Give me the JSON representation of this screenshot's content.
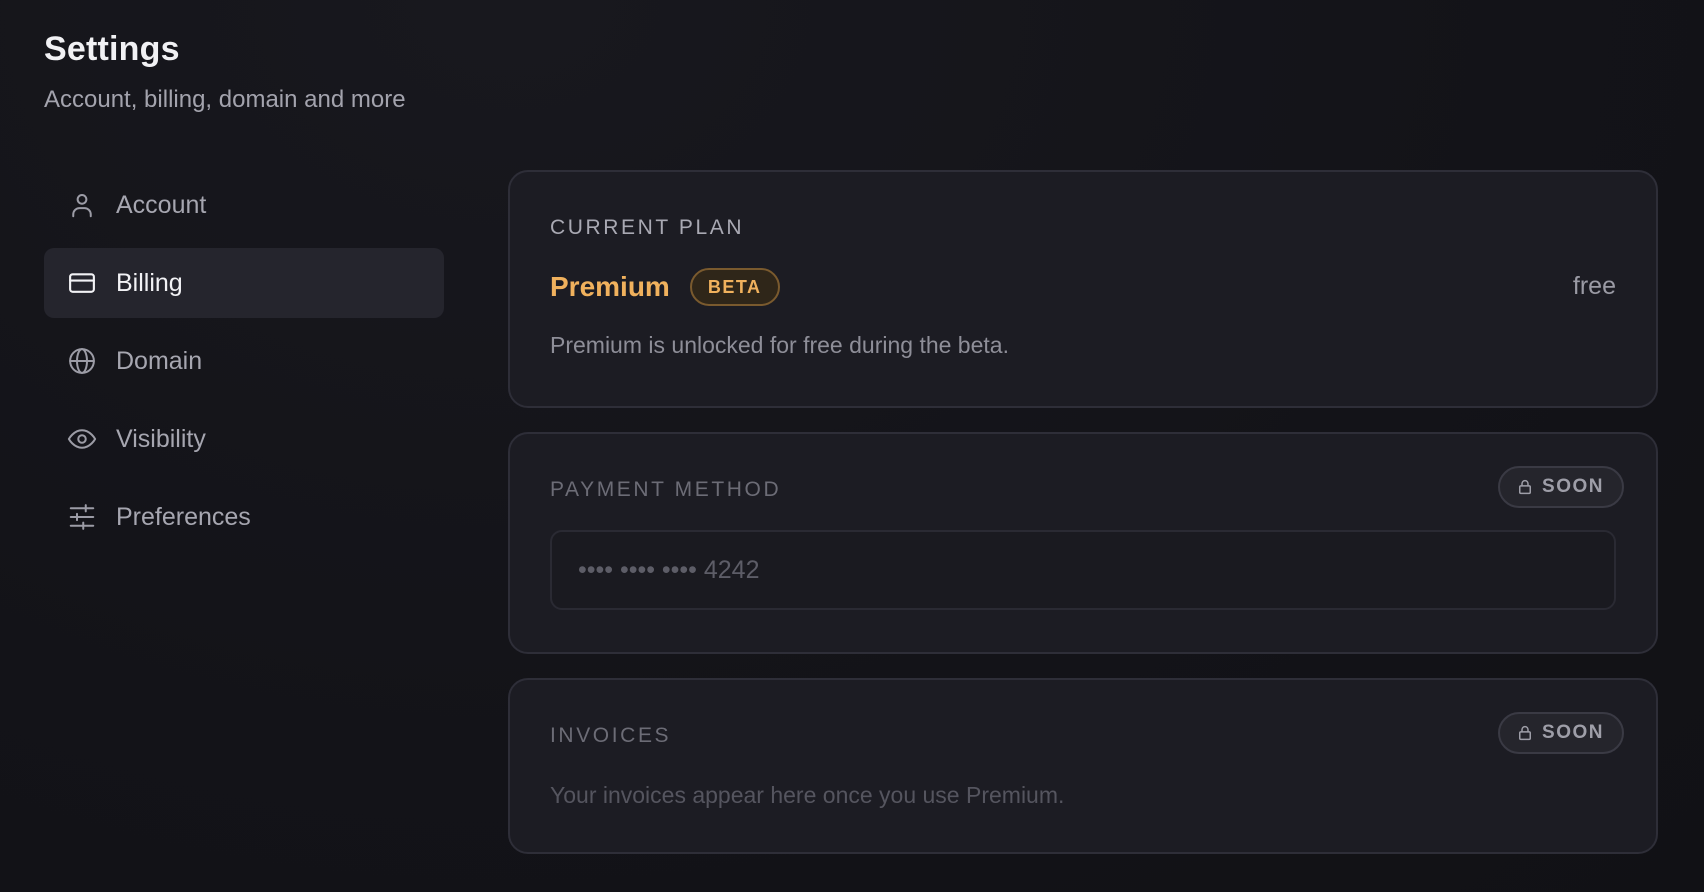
{
  "header": {
    "title": "Settings",
    "subtitle": "Account, billing, domain and more"
  },
  "sidebar": {
    "items": [
      {
        "label": "Account",
        "icon": "user-icon",
        "active": false
      },
      {
        "label": "Billing",
        "icon": "credit-card-icon",
        "active": true
      },
      {
        "label": "Domain",
        "icon": "globe-icon",
        "active": false
      },
      {
        "label": "Visibility",
        "icon": "eye-icon",
        "active": false
      },
      {
        "label": "Preferences",
        "icon": "sliders-icon",
        "active": false
      }
    ]
  },
  "current_plan": {
    "label": "CURRENT PLAN",
    "plan_name": "Premium",
    "badge": "BETA",
    "price": "free",
    "description": "Premium is unlocked for free during the beta."
  },
  "payment_method": {
    "label": "PAYMENT METHOD",
    "badge": "SOON",
    "card_value": "•••• •••• •••• 4242"
  },
  "invoices": {
    "label": "INVOICES",
    "badge": "SOON",
    "description": "Your invoices appear here once you use Premium."
  },
  "colors": {
    "accent": "#f0b15d",
    "background": "#131318",
    "card": "#1c1c23",
    "active_nav": "#25252d"
  }
}
